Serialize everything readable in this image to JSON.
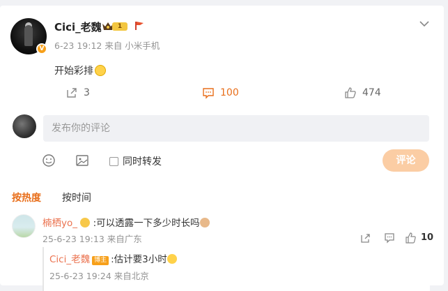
{
  "post": {
    "author": "Cici_老魏",
    "verified_badge": "V",
    "level_badge": "1",
    "meta": "6-23 19:12  来自 小米手机",
    "text": "开始彩排",
    "actions": {
      "repost_count": "3",
      "comment_count": "100",
      "like_count": "474"
    }
  },
  "composer": {
    "placeholder": "发布你的评论",
    "repost_option": "同时转发",
    "submit_label": "评论"
  },
  "sort": {
    "hot": "按热度",
    "time": "按时间"
  },
  "comments": [
    {
      "author": "楠栖yo_",
      "text": ":可以透露一下多少时长吗",
      "meta": "25-6-23 19:13 来自广东",
      "like_count": "10",
      "reply": {
        "author": "Cici_老魏",
        "badge": "博主",
        "text": ":估计要3小时",
        "meta": "25-6-23 19:24 来自北京"
      }
    }
  ],
  "colors": {
    "accent": "#e86e1a",
    "name": "#eb7350",
    "submit_disabled": "#fbcda4",
    "muted": "#939393"
  }
}
